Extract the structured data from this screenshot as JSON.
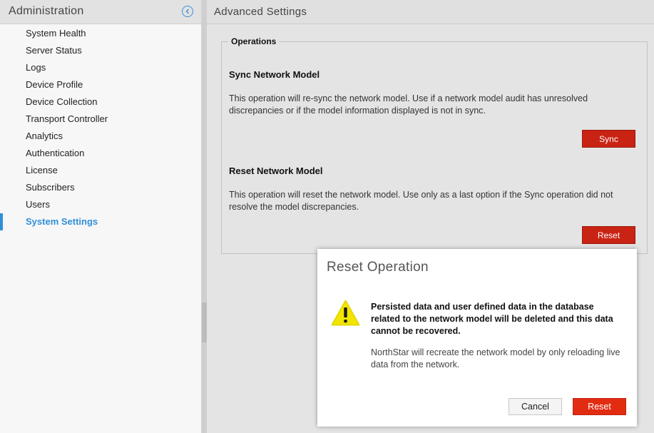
{
  "sidebar": {
    "title": "Administration",
    "collapse_icon": "chevron-left-icon",
    "items": [
      {
        "label": "System Health"
      },
      {
        "label": "Server Status"
      },
      {
        "label": "Logs"
      },
      {
        "label": "Device Profile"
      },
      {
        "label": "Device Collection"
      },
      {
        "label": "Transport Controller"
      },
      {
        "label": "Analytics"
      },
      {
        "label": "Authentication"
      },
      {
        "label": "License"
      },
      {
        "label": "Subscribers"
      },
      {
        "label": "Users"
      },
      {
        "label": "System Settings",
        "active": true
      }
    ]
  },
  "main": {
    "title": "Advanced Settings",
    "operations": {
      "legend": "Operations",
      "sync": {
        "title": "Sync Network Model",
        "description": "This operation will re-sync the network model. Use if a network model audit has unresolved discrepancies or if the model information displayed is not in sync.",
        "button": "Sync"
      },
      "reset": {
        "title": "Reset Network Model",
        "description": "This operation will reset the network model. Use only as a last option if the Sync operation did not resolve the model discrepancies.",
        "button": "Reset"
      }
    }
  },
  "dialog": {
    "title": "Reset Operation",
    "icon": "warning-icon",
    "warning": "Persisted data and user defined data in the database related to the network model will be deleted and this data cannot be recovered.",
    "info": "NorthStar will recreate the network model by only reloading live data from the network.",
    "cancel_label": "Cancel",
    "confirm_label": "Reset"
  },
  "colors": {
    "accent": "#2f8fd8",
    "danger_button": "#c82313",
    "dialog_reset": "#e22c12",
    "warning_yellow": "#f2e600"
  }
}
